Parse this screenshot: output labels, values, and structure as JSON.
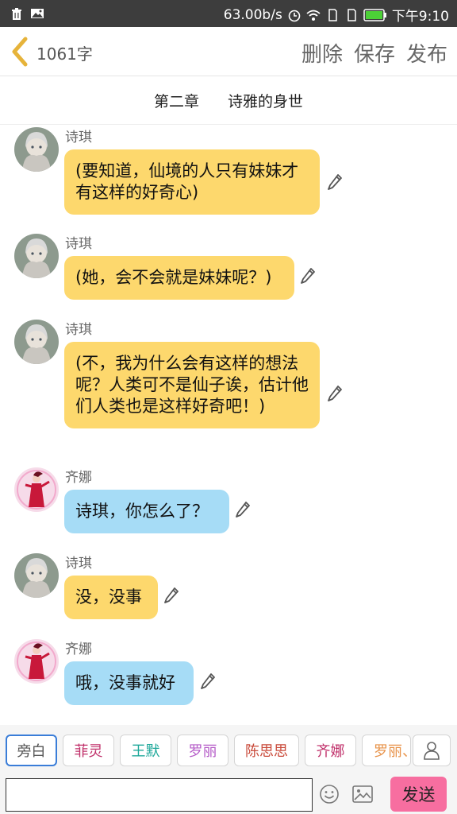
{
  "status_bar": {
    "speed": "63.00b/s",
    "time": "下午9:10"
  },
  "header": {
    "word_count": "1061字",
    "delete_label": "删除",
    "save_label": "保存",
    "publish_label": "发布"
  },
  "chapter": {
    "number": "第二章",
    "title": "诗雅的身世"
  },
  "messages": [
    {
      "speaker": "诗琪",
      "text": "(要知道，仙境的人只有妹妹才有这样的好奇心)",
      "color": "#fdd86d"
    },
    {
      "speaker": "诗琪",
      "text": "(她，会不会就是妹妹呢？)",
      "color": "#fdd86d"
    },
    {
      "speaker": "诗琪",
      "text": "(不，我为什么会有这样的想法呢？人类可不是仙子诶，估计他们人类也是这样好奇吧！)",
      "color": "#fdd86d"
    },
    {
      "speaker": "齐娜",
      "text": "诗琪，你怎么了？",
      "color": "#a6dcf6"
    },
    {
      "speaker": "诗琪",
      "text": "没，没事",
      "color": "#fdd86d"
    },
    {
      "speaker": "齐娜",
      "text": "哦，没事就好",
      "color": "#a6dcf6"
    }
  ],
  "roles": [
    {
      "label": "旁白",
      "color": "#555555"
    },
    {
      "label": "菲灵",
      "color": "#c0306a"
    },
    {
      "label": "王默",
      "color": "#1fa89a"
    },
    {
      "label": "罗丽",
      "color": "#b55cc8"
    },
    {
      "label": "陈思思",
      "color": "#c94a3a"
    },
    {
      "label": "齐娜",
      "color": "#c0306a"
    },
    {
      "label": "罗丽、",
      "color": "#e8934a"
    }
  ],
  "input": {
    "value": "",
    "placeholder": ""
  },
  "send_label": "发送",
  "icons": [
    "trash-icon",
    "gallery-icon",
    "alarm-icon",
    "wifi-icon",
    "sim-icon",
    "battery-icon",
    "back-chevron-icon",
    "pencil-icon",
    "person-icon",
    "emoji-icon",
    "image-icon"
  ],
  "accent_colors": {
    "send": "#f76ea0",
    "selected_chip": "#3a7dd8",
    "back_chevron": "#e6b33a"
  }
}
